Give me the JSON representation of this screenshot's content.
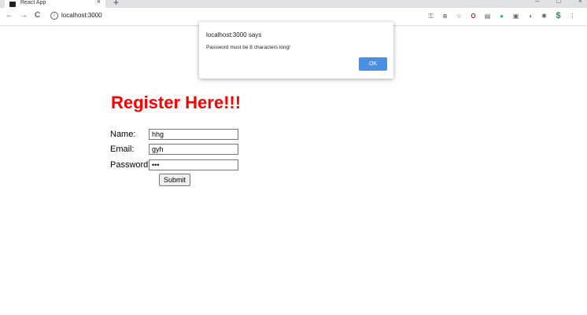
{
  "browser": {
    "tab_title": "React App",
    "tab_close": "×",
    "new_tab": "+",
    "window_controls": [
      "–",
      "□",
      "×"
    ],
    "url": "localhost:3000",
    "nav": {
      "back": "←",
      "forward": "→",
      "reload": "C"
    },
    "extension_glyphs": [
      "⚿",
      "⊕",
      "☆",
      "O",
      "▤",
      "●",
      "▣",
      "◑",
      "✱",
      "$",
      "⋮"
    ]
  },
  "alert": {
    "title": "localhost:3000 says",
    "message": "Password must be 8 characters long!",
    "ok_label": "OK"
  },
  "form": {
    "heading": "Register Here!!!",
    "name_label": "Name:",
    "name_value": "hhg",
    "email_label": "Email:",
    "email_value": "gyh",
    "password_label": "Password:",
    "password_value": "•••",
    "submit_label": "Submit"
  },
  "colors": {
    "heading": "#ff0000",
    "ok_button": "#4a90e2"
  }
}
